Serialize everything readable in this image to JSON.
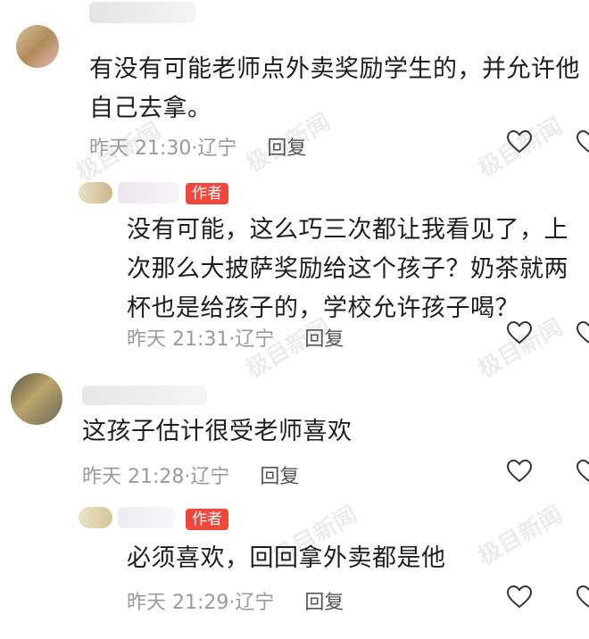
{
  "comments": [
    {
      "text_lines": [
        "有没有可能老师点外卖奖励学生的，并允许他",
        "自己去拿。"
      ],
      "time": "昨天 21:30",
      "location": "辽宁",
      "reply_label": "回复"
    },
    {
      "author_badge": "作者",
      "text_lines": [
        "没有可能，这么巧三次都让我看见了，上",
        "次那么大披萨奖励给这个孩子？奶茶就两",
        "杯也是给孩子的，学校允许孩子喝？"
      ],
      "time": "昨天 21:31",
      "location": "辽宁",
      "reply_label": "回复"
    },
    {
      "text_lines": [
        "这孩子估计很受老师喜欢"
      ],
      "time": "昨天 21:28",
      "location": "辽宁",
      "reply_label": "回复"
    },
    {
      "author_badge": "作者",
      "text_lines": [
        "必须喜欢，回回拿外卖都是他"
      ],
      "time": "昨天 21:29",
      "location": "辽宁",
      "reply_label": "回复"
    }
  ],
  "watermark": "极目新闻",
  "colors": {
    "author_badge_bg": "#f0463c",
    "meta_text": "#9a9a9a",
    "reply_text": "#555555"
  },
  "icons": {
    "like": "heart-outline-icon"
  }
}
